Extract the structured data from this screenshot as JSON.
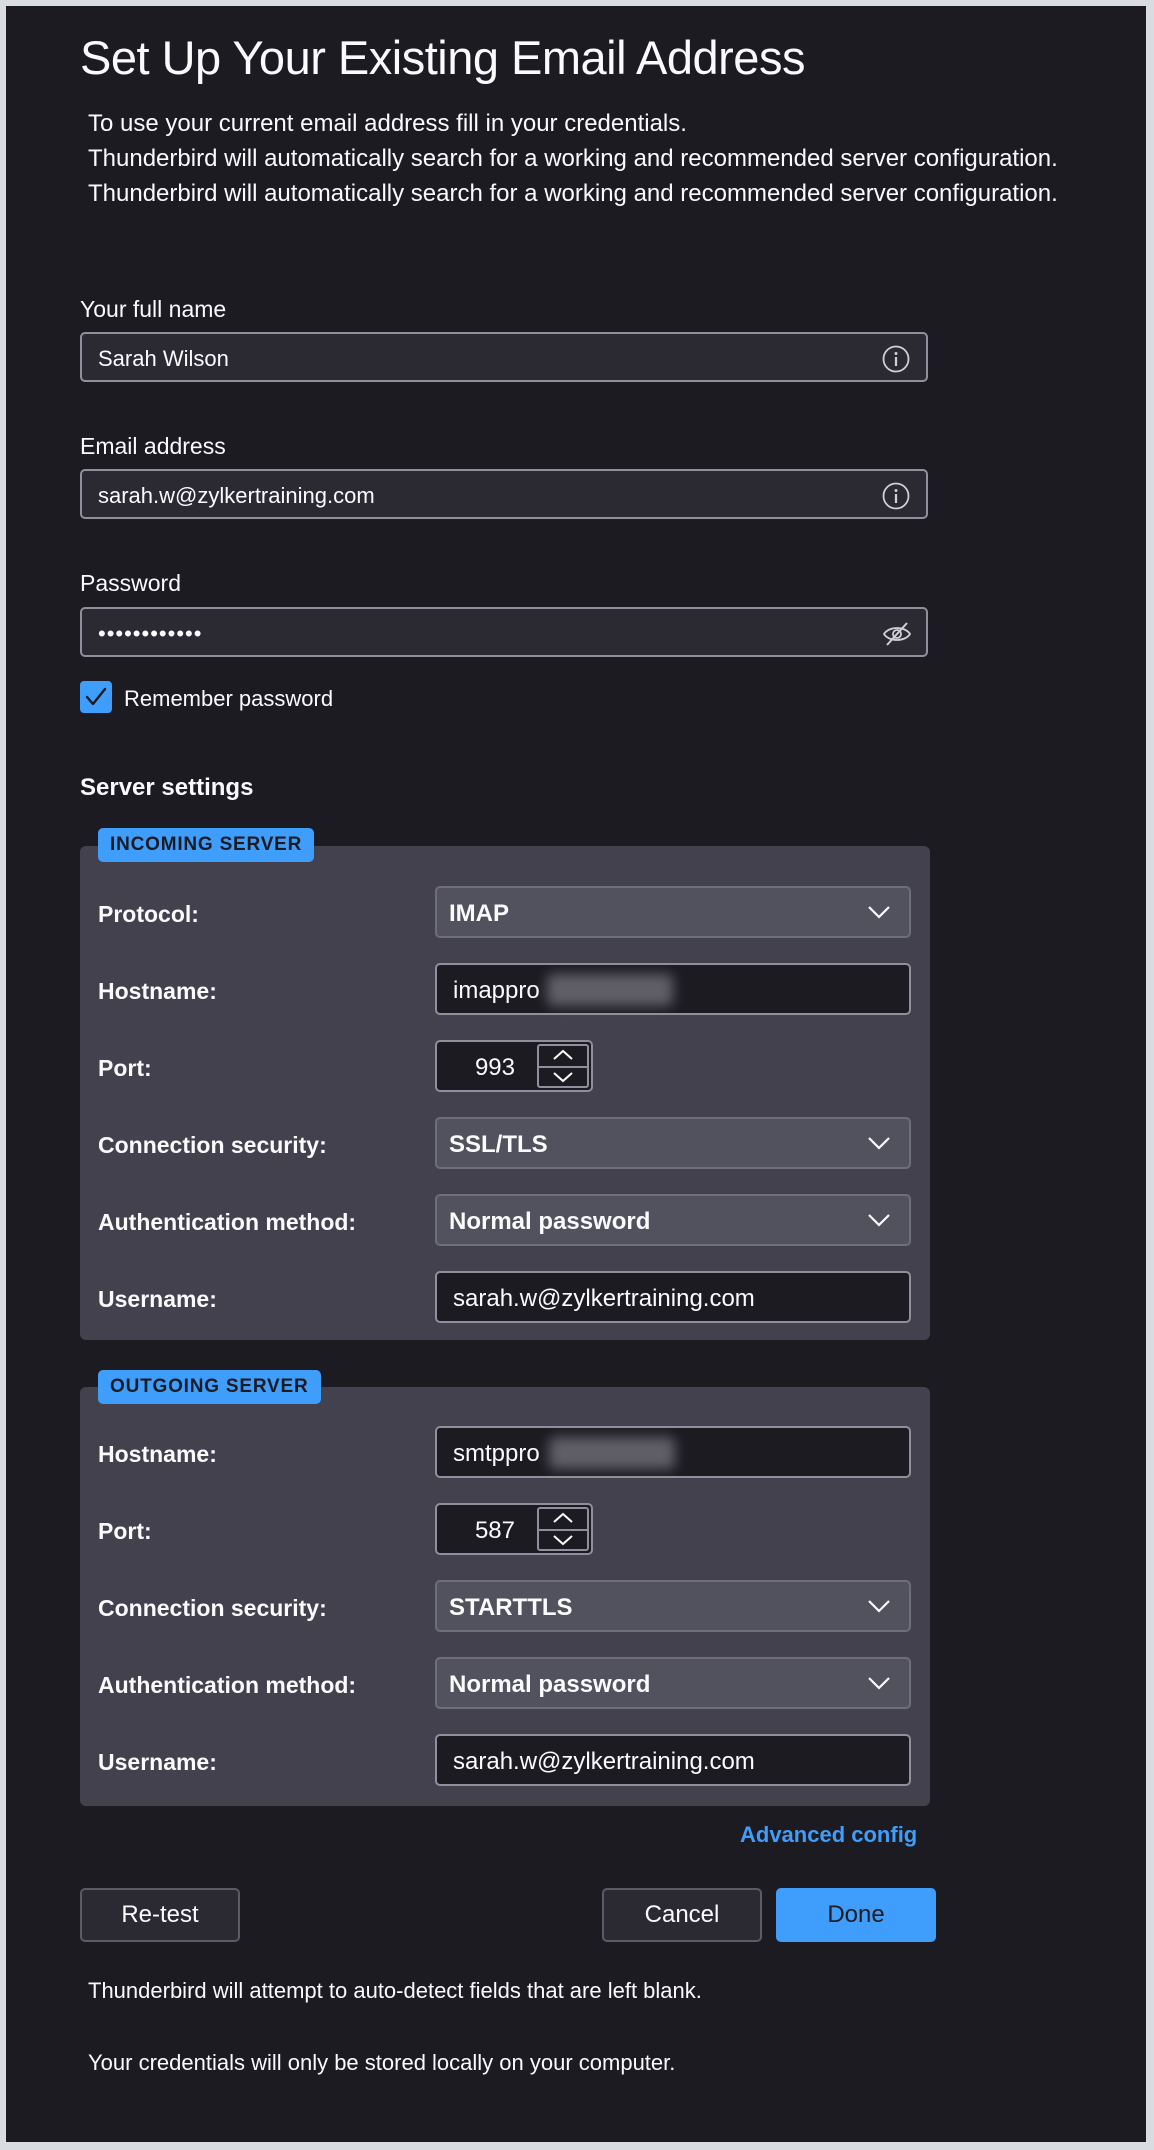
{
  "header": {
    "title": "Set Up Your Existing Email Address",
    "intro_lines": [
      "To use your current email address fill in your credentials.",
      "Thunderbird will automatically search for a working and recommended server configuration.",
      "Thunderbird will automatically search for a working and recommended server configuration."
    ]
  },
  "form": {
    "full_name": {
      "label": "Your full name",
      "value": "Sarah Wilson"
    },
    "email": {
      "label": "Email address",
      "value": "sarah.w@zylkertraining.com"
    },
    "password": {
      "label": "Password",
      "value": "••••••••••••"
    },
    "remember_password": {
      "label": "Remember password",
      "checked": true
    }
  },
  "server_settings": {
    "heading": "Server settings",
    "incoming": {
      "legend": "INCOMING SERVER",
      "protocol": {
        "label": "Protocol:",
        "value": "IMAP"
      },
      "hostname": {
        "label": "Hostname:",
        "value": "imappro"
      },
      "port": {
        "label": "Port:",
        "value": "993"
      },
      "security": {
        "label": "Connection security:",
        "value": "SSL/TLS"
      },
      "auth": {
        "label": "Authentication method:",
        "value": "Normal password"
      },
      "username": {
        "label": "Username:",
        "value": "sarah.w@zylkertraining.com"
      }
    },
    "outgoing": {
      "legend": "OUTGOING SERVER",
      "hostname": {
        "label": "Hostname:",
        "value": "smtppro"
      },
      "port": {
        "label": "Port:",
        "value": "587"
      },
      "security": {
        "label": "Connection security:",
        "value": "STARTTLS"
      },
      "auth": {
        "label": "Authentication method:",
        "value": "Normal password"
      },
      "username": {
        "label": "Username:",
        "value": "sarah.w@zylkertraining.com"
      }
    },
    "advanced_link": "Advanced config"
  },
  "buttons": {
    "retest": "Re-test",
    "cancel": "Cancel",
    "done": "Done"
  },
  "footer": {
    "notes": [
      "Thunderbird will attempt to auto-detect fields that are left blank.",
      "Your credentials will only be stored locally on your computer."
    ]
  },
  "colors": {
    "background": "#1c1b22",
    "panel": "#42414d",
    "accent": "#3f9efc",
    "text": "#fbfbfe"
  },
  "icons": {
    "full_name_info": "info-icon",
    "email_info": "info-icon",
    "password_toggle": "eye-slash-icon",
    "dropdown": "chevron-down-icon",
    "checkbox": "checkmark-icon"
  }
}
